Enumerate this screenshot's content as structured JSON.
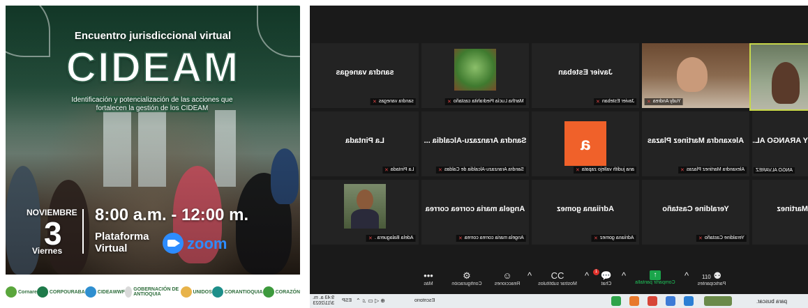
{
  "poster": {
    "title": "Encuentro jurisdiccional virtual",
    "brand": "CIDEAM",
    "subtitle_line1": "Identificación y potencialización de las acciones que",
    "subtitle_line2": "fortalecen la gestión de los CIDEAM",
    "month": "NOVIEMBRE",
    "day": "3",
    "weekday": "Viernes",
    "time": "8:00 a.m. - 12:00 m.",
    "platform_line1": "Plataforma",
    "platform_line2": "Virtual",
    "zoom_word": "zoom",
    "logos": [
      "Cornare",
      "CORPOURABA",
      "CIDEA",
      "WWF",
      "GOBERNACIÓN DE ANTIOQUIA",
      "UNIDOS",
      "CORANTIOQUIA",
      "CORAZÓN"
    ]
  },
  "zoom": {
    "participants": [
      {
        "display": "sandra vanegas",
        "label": "sandra vanegas",
        "kind": "name"
      },
      {
        "display": "",
        "label": "Martha Lucía Piedrahita castaño",
        "kind": "plant-photo"
      },
      {
        "display": "Javier Esteban",
        "label": "Javier Esteban",
        "kind": "name"
      },
      {
        "display": "",
        "label": "Yudy Andrea",
        "kind": "video"
      },
      {
        "display": "",
        "label": "",
        "kind": "video-far"
      },
      {
        "display": "La Pintada",
        "label": "La Pintada",
        "kind": "name"
      },
      {
        "display": "Sandra Aranzazu-Alcaldia ...",
        "label": "Sandra Aranzazu-Alcaldia de Caldas",
        "kind": "name"
      },
      {
        "display": "a",
        "label": "ana judith vallejo zapata",
        "kind": "avatar"
      },
      {
        "display": "Alexandra Martinez Plazas",
        "label": "Alexandra Martinez Plazas",
        "kind": "name"
      },
      {
        "display": "Y ARANGO AL...",
        "label": "ANGO ALVAREZ",
        "kind": "name"
      },
      {
        "display": "",
        "label": "Adela Balaguera .",
        "kind": "person-photo"
      },
      {
        "display": "Angela maria correa correa",
        "label": "Angela maria correa correa",
        "kind": "name"
      },
      {
        "display": "Adriiana gomez",
        "label": "Adriiana gomez",
        "kind": "name"
      },
      {
        "display": "Yeraldine Castaño",
        "label": "Yeraldine Castaño",
        "kind": "name"
      },
      {
        "display": "Martinez",
        "label": "",
        "kind": "name"
      }
    ],
    "toolbar": {
      "more": "Más",
      "settings": "Configuración",
      "reactions": "Reacciones",
      "subtitles": "Mostrar subtítulos",
      "chat": "Chat",
      "chat_badge": "1",
      "share": "Compartir pantalla",
      "participants": "Participantes",
      "participants_count": "110"
    },
    "taskbar": {
      "time": "9:43 a. m.",
      "date": "3/11/2023",
      "lang": "ESP",
      "status": "Escritorio",
      "search": "para buscar."
    }
  }
}
